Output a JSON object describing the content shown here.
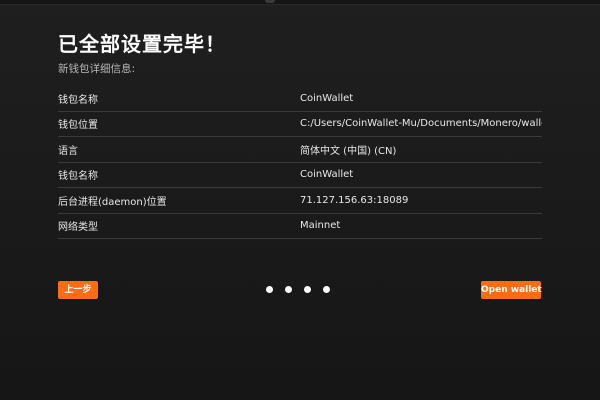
{
  "header": {
    "title": "已全部设置完毕！",
    "subtitle": "新钱包详细信息:"
  },
  "details": [
    {
      "label": "钱包名称",
      "value": "CoinWallet"
    },
    {
      "label": "钱包位置",
      "value": "C:/Users/CoinWallet-Mu/Documents/Monero/wallets/"
    },
    {
      "label": "语言",
      "value": "简体中文 (中国) (CN)"
    },
    {
      "label": "钱包名称",
      "value": "CoinWallet"
    },
    {
      "label": "后台进程(daemon)位置",
      "value": "71.127.156.63:18089"
    },
    {
      "label": "网络类型",
      "value": "Mainnet"
    }
  ],
  "navigation": {
    "prev_label": "上一步",
    "open_label": "Open wallet",
    "step_dots": 4
  },
  "colors": {
    "accent": "#ff6c12",
    "background": "#1c1c1c",
    "divider": "#3a3a3a"
  }
}
